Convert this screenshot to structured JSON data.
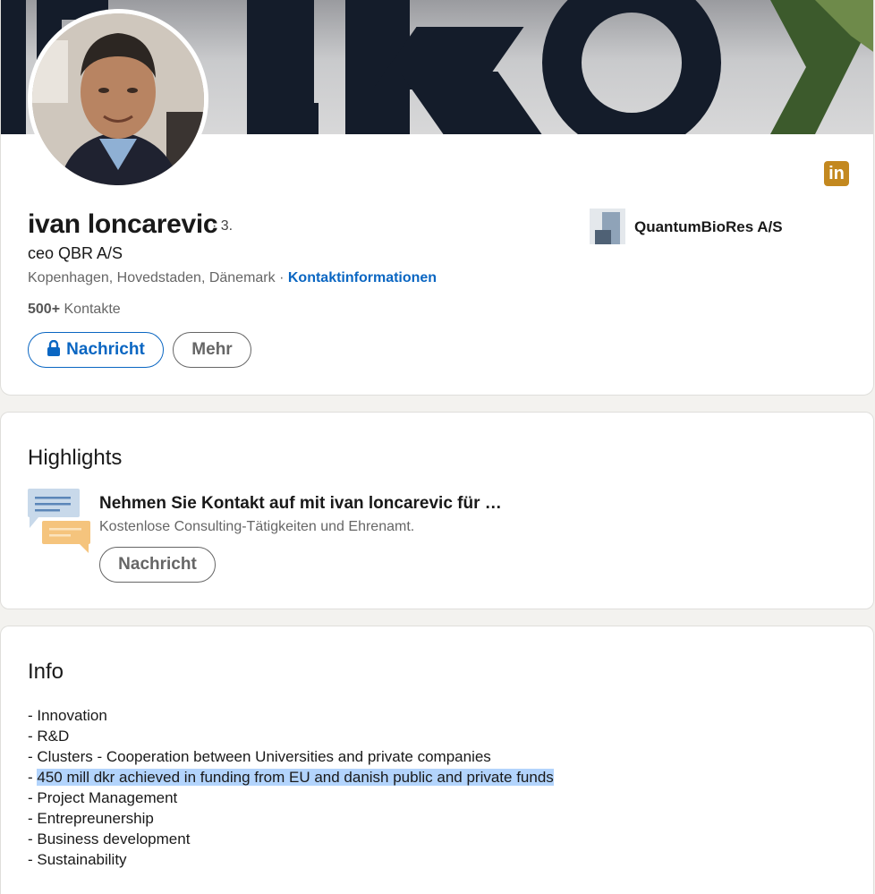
{
  "profile": {
    "name": "ivan loncarevic",
    "degree": "· 3.",
    "headline": "ceo QBR A/S",
    "location": "Kopenhagen, Hovedstaden, Dänemark",
    "separator": " · ",
    "contact_info_label": "Kontaktinformationen",
    "connections_count": "500+",
    "connections_label": "Kontakte",
    "message_button": "Nachricht",
    "more_button": "Mehr",
    "company": "QuantumBioRes A/S",
    "banner_text": "ELKO",
    "linkedin_badge": "in"
  },
  "colors": {
    "accent": "#0a66c2",
    "linkedin_badge": "#c3881f",
    "selection": "#b3d4fc"
  },
  "highlights": {
    "title": "Highlights",
    "item_title": "Nehmen Sie Kontakt auf mit ivan loncarevic für …",
    "item_subtitle": "Kostenlose Consulting-Tätigkeiten und Ehrenamt.",
    "button": "Nachricht"
  },
  "info": {
    "title": "Info",
    "lines": [
      "- Innovation",
      "- R&D",
      "- Clusters - Cooperation between Universities and private companies",
      "450 mill dkr achieved in funding from EU and danish public and private funds",
      "- Project Management",
      "- Entrepreunership",
      "- Business development",
      "- Sustainability"
    ],
    "highlight_prefix": "- "
  }
}
